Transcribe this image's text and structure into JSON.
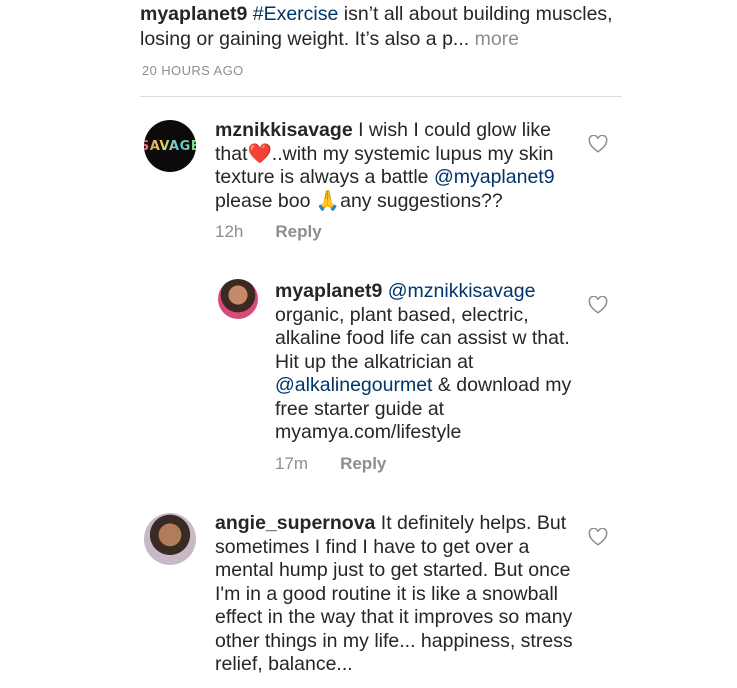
{
  "post": {
    "username": "myaplanet9",
    "hashtag": "#Exercise",
    "text": " isn’t all about building muscles, losing or gaining weight. It’s also a p...",
    "more_label": " more",
    "timestamp": "20 HOURS AGO"
  },
  "comments": [
    {
      "username": "mznikkisavage",
      "avatar_text": "SAVAGE",
      "text_a": " I wish I could glow like that❤️..with my systemic lupus my skin texture is always a battle ",
      "mention": "@myaplanet9",
      "text_b": " please boo 🙏any suggestions??",
      "time": "12h",
      "reply_label": "Reply"
    },
    {
      "username": "myaplanet9",
      "mention_a": "@mznikkisavage",
      "text_a": " organic, plant based, electric, alkaline food life can assist w that. Hit up the alkatrician at ",
      "mention_b": "@alkalinegourmet",
      "text_b": " & download my free starter guide at myamya.com/lifestyle",
      "time": "17m",
      "reply_label": "Reply"
    },
    {
      "username": "angie_supernova",
      "text": " It definitely helps. But sometimes I find I have to get over a mental hump just to get started. But once I'm in a good routine it is like a snowball effect in the way that it improves so many other things in my life... happiness, stress relief, balance..."
    }
  ],
  "icons": {
    "like": "heart-outline-icon"
  }
}
